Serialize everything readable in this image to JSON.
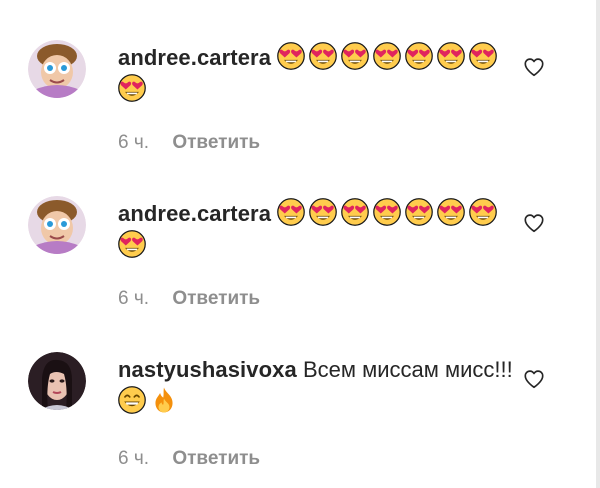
{
  "comments": [
    {
      "username": "andree.cartera",
      "text": "",
      "emoji": [
        "heart-eyes",
        "heart-eyes",
        "heart-eyes",
        "heart-eyes",
        "heart-eyes",
        "heart-eyes",
        "heart-eyes",
        "heart-eyes"
      ],
      "time": "6 ч.",
      "reply_label": "Ответить"
    },
    {
      "username": "andree.cartera",
      "text": "",
      "emoji": [
        "heart-eyes",
        "heart-eyes",
        "heart-eyes",
        "heart-eyes",
        "heart-eyes",
        "heart-eyes",
        "heart-eyes",
        "heart-eyes"
      ],
      "time": "6 ч.",
      "reply_label": "Ответить"
    },
    {
      "username": "nastyushasivoxa",
      "text": "Всем миссам мисс!!!",
      "emoji": [
        "grinning-smiling-eyes",
        "fire"
      ],
      "time": "6 ч.",
      "reply_label": "Ответить"
    }
  ],
  "icons": {
    "like": "heart-outline-icon"
  },
  "colors": {
    "text": "#262626",
    "muted": "#8e8e8e",
    "emoji_face": "#ffcc4d",
    "emoji_heart": "#e0245e"
  }
}
